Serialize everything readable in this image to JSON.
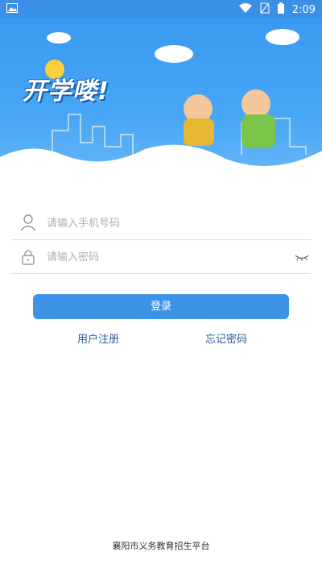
{
  "status_bar": {
    "time": "2:09"
  },
  "hero": {
    "headline": "开学喽!"
  },
  "login_form": {
    "phone_placeholder": "请输入手机号码",
    "password_placeholder": "请输入密码",
    "login_label": "登录"
  },
  "links": {
    "register": "用户注册",
    "forgot": "忘记密码"
  },
  "footer": {
    "text": "襄阳市义务教育招生平台"
  },
  "colors": {
    "primary": "#3d93e6",
    "link": "#2c5aa0",
    "hero_blue": "#3a9af0"
  }
}
